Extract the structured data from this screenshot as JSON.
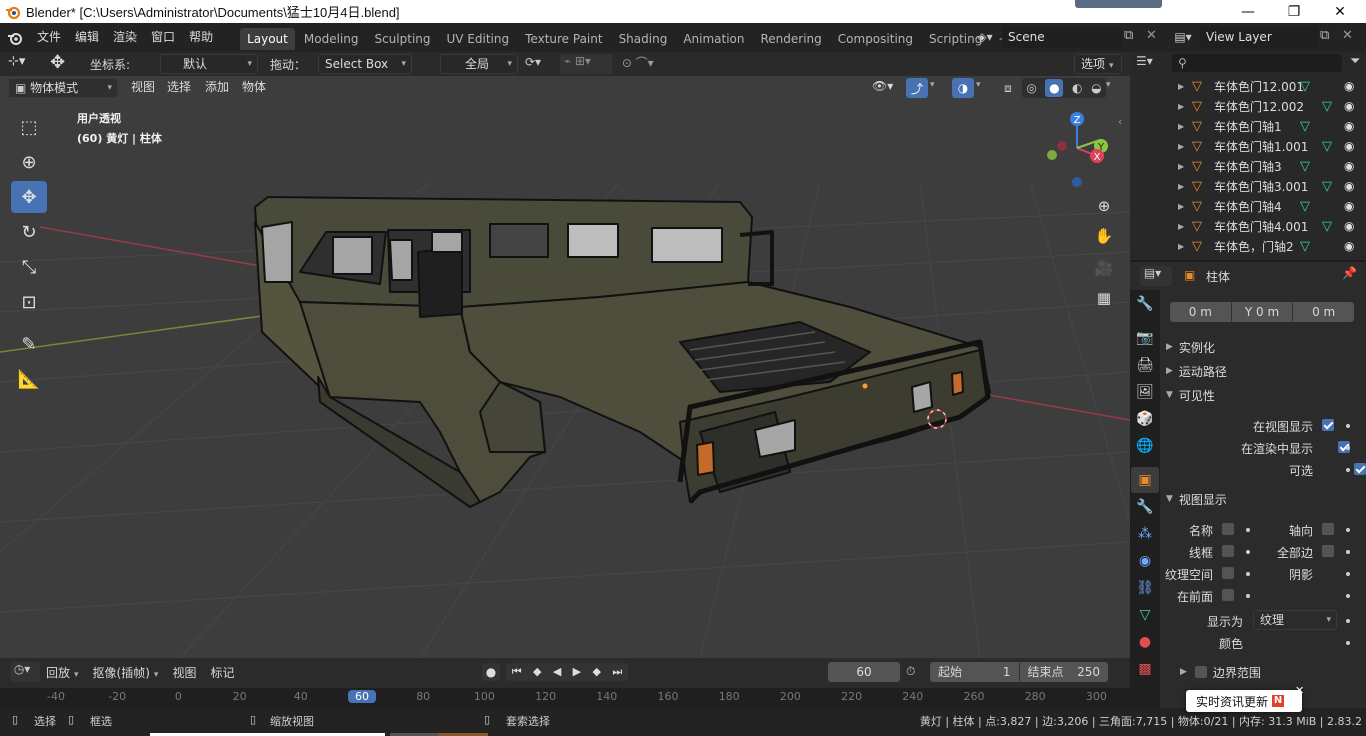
{
  "window": {
    "title": "Blender* [C:\\Users\\Administrator\\Documents\\猛士10月4日.blend]",
    "minimize": "—",
    "maximize": "❐",
    "close": "✕"
  },
  "menus": [
    "文件",
    "编辑",
    "渲染",
    "窗口",
    "帮助"
  ],
  "workspaces": [
    "Layout",
    "Modeling",
    "Sculpting",
    "UV Editing",
    "Texture Paint",
    "Shading",
    "Animation",
    "Rendering",
    "Compositing",
    "Scripting",
    "+"
  ],
  "scene": {
    "name": "Scene",
    "view_layer": "View Layer"
  },
  "header": {
    "coord_label": "坐标系:",
    "coord_value": "默认",
    "drag_label": "拖动：",
    "drag_value": "Select Box",
    "pivot_value": "全局",
    "options": "选项"
  },
  "viewport_header": {
    "mode": "物体模式",
    "menu": [
      "视图",
      "选择",
      "添加",
      "物体"
    ]
  },
  "viewport": {
    "view_name": "用户透视",
    "object_info": "(60) 黄灯 | 柱体",
    "gizmo": {
      "z": "Z",
      "y": "Y",
      "x": "X"
    }
  },
  "outliner": {
    "items": [
      "车体色门12.001",
      "车体色门12.002",
      "车体色门轴1",
      "车体色门轴1.001",
      "车体色门轴3",
      "车体色门轴3.001",
      "车体色门轴4",
      "车体色门轴4.001",
      "车体色，门轴2"
    ],
    "search_placeholder": ""
  },
  "properties": {
    "object_name": "柱体",
    "delta": [
      "0 m",
      "Y 0 m",
      "0 m"
    ],
    "sections": {
      "instancing": "实例化",
      "motion_paths": "运动路径",
      "visibility": "可见性",
      "viewport_display": "视图显示",
      "bounds": "边界范围"
    },
    "visibility": {
      "show_in_viewport": "在视图显示",
      "show_in_render": "在渲染中显示",
      "selectable": "可选"
    },
    "display": {
      "name": "名称",
      "axis": "轴向",
      "wire": "线框",
      "all_edges": "全部边",
      "texture_space": "纹理空间",
      "shadow": "阴影",
      "in_front": "在前面",
      "display_as_label": "显示为",
      "display_as_value": "纹理",
      "color_label": "颜色"
    }
  },
  "timeline": {
    "menus": [
      "回放",
      "抠像(插帧)",
      "视图",
      "标记"
    ],
    "current_frame": "60",
    "start_label": "起始",
    "start_value": "1",
    "end_label": "结束点",
    "end_value": "250",
    "ticks": [
      "-40",
      "-20",
      "0",
      "20",
      "40",
      "60",
      "80",
      "100",
      "120",
      "140",
      "160",
      "180",
      "200",
      "220",
      "240",
      "260",
      "280",
      "300"
    ]
  },
  "statusbar": {
    "select": "选择",
    "box_select": "框选",
    "zoom_view": "缩放视图",
    "lasso_select": "套索选择",
    "stats": "黄灯 | 柱体 | 点:3,827 | 边:3,206 | 三角面:7,715 | 物体:0/21 | 内存: 31.3 MiB | 2.83.2"
  },
  "notification": {
    "text": "实时资讯更新",
    "badge": "N"
  },
  "colors": {
    "accent": "#4772b3",
    "viewport_bg": "#3d3d3d",
    "panel_bg": "#2b2b2b",
    "x_axis": "#e0405a",
    "y_axis": "#8cc63f",
    "z_axis": "#3b7fe0",
    "mesh_icon": "#e88b2a",
    "eye_icon": "#e0e0e0",
    "vertex_icon": "#3fd18f"
  }
}
